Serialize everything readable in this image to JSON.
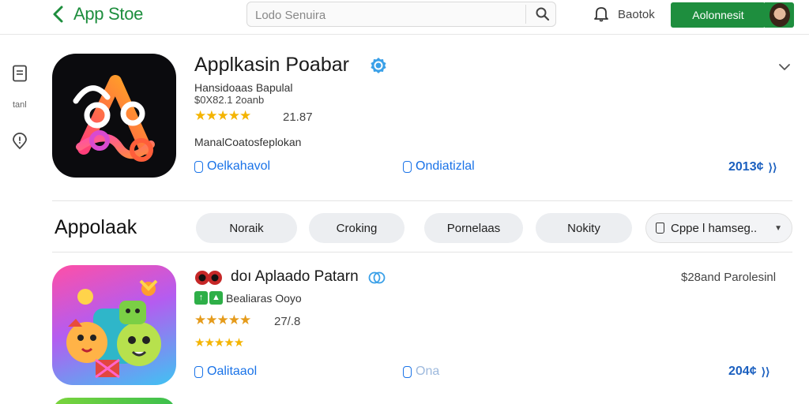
{
  "colors": {
    "brand": "#1e8e3e",
    "link": "#1a73e8",
    "star": "#f4b400",
    "price": "#1a5fbf"
  },
  "header": {
    "title": "App Stoe",
    "search_placeholder": "Lodo Senuira",
    "notifications_label": "Baotok",
    "primary_button": "Aolonnesit"
  },
  "rail": {
    "doc_label": "tanl"
  },
  "featured": {
    "name": "Applkasin Poabar",
    "developer": "Hansidoaas Bapulal",
    "meta": "$0X82.1 2oanb",
    "stars": "★★★★★",
    "rating": "21.87",
    "description": "ManalCoatosfeplokan",
    "link_left": "Oelkahavol",
    "link_right": "Ondiatizlal",
    "price": "2013¢"
  },
  "section": {
    "title": "Appolaak",
    "chips": [
      "Noraik",
      "Croking",
      "Pornelaas",
      "Nokity"
    ],
    "dropdown_chip": "Cppe l hamseg.."
  },
  "app2": {
    "name": "doı Aplaado Patarn",
    "developer": "Bealiaras Ooyo",
    "stars_row1": "★★★★★",
    "rating": "27/.8",
    "stars_row2": "★★★★★",
    "price_top": "$28and Parolesinl",
    "link_left": "Oalitaaol",
    "link_right": "Ona",
    "price": "204¢"
  }
}
